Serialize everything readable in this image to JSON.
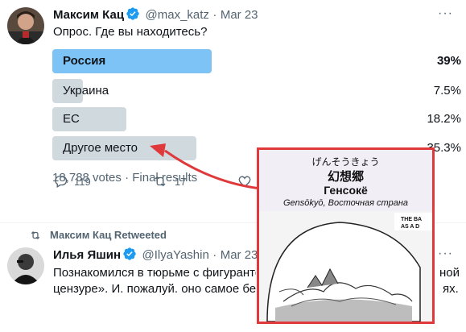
{
  "tweet1": {
    "name": "Максим Кац",
    "handle": "@max_katz",
    "date": "Mar 23",
    "separator": "·",
    "more": "···",
    "text": "Опрос. Где вы находитесь?",
    "poll": {
      "options": [
        {
          "label": "Россия",
          "percent": "39%",
          "value": 39.0,
          "winner": true
        },
        {
          "label": "Украина",
          "percent": "7.5%",
          "value": 7.5,
          "winner": false
        },
        {
          "label": "ЕС",
          "percent": "18.2%",
          "value": 18.2,
          "winner": false
        },
        {
          "label": "Другое место",
          "percent": "35.3%",
          "value": 35.3,
          "winner": false
        }
      ],
      "votes": "18,788 votes",
      "status": "Final results"
    },
    "actions": {
      "replies": "119",
      "retweets": "17"
    }
  },
  "retweet_banner": "Максим Кац Retweeted",
  "tweet2": {
    "name": "Илья Яшин",
    "handle": "@IlyaYashin",
    "date": "Mar 23",
    "separator": "·",
    "more": "···",
    "line1": "Познакомился в тюрьме с фигурантом",
    "line1_end": "ной",
    "line2": "цензуре». И. пожалуй. оно самое без",
    "line2_end": "ях."
  },
  "overlay": {
    "kana": "げんそうきょう",
    "kanji": "幻想郷",
    "title_ru": "Генсокё",
    "caption": "Gensōkyō, Восточная страна",
    "manga_text_line1": "THE BA",
    "manga_text_line2": "AS A D"
  },
  "colors": {
    "accent": "#1d9bf0",
    "winner_bar": "#7dc3f6",
    "bar": "#cfd9de",
    "overlay_border": "#e0393b",
    "arrow": "#e0393b"
  }
}
